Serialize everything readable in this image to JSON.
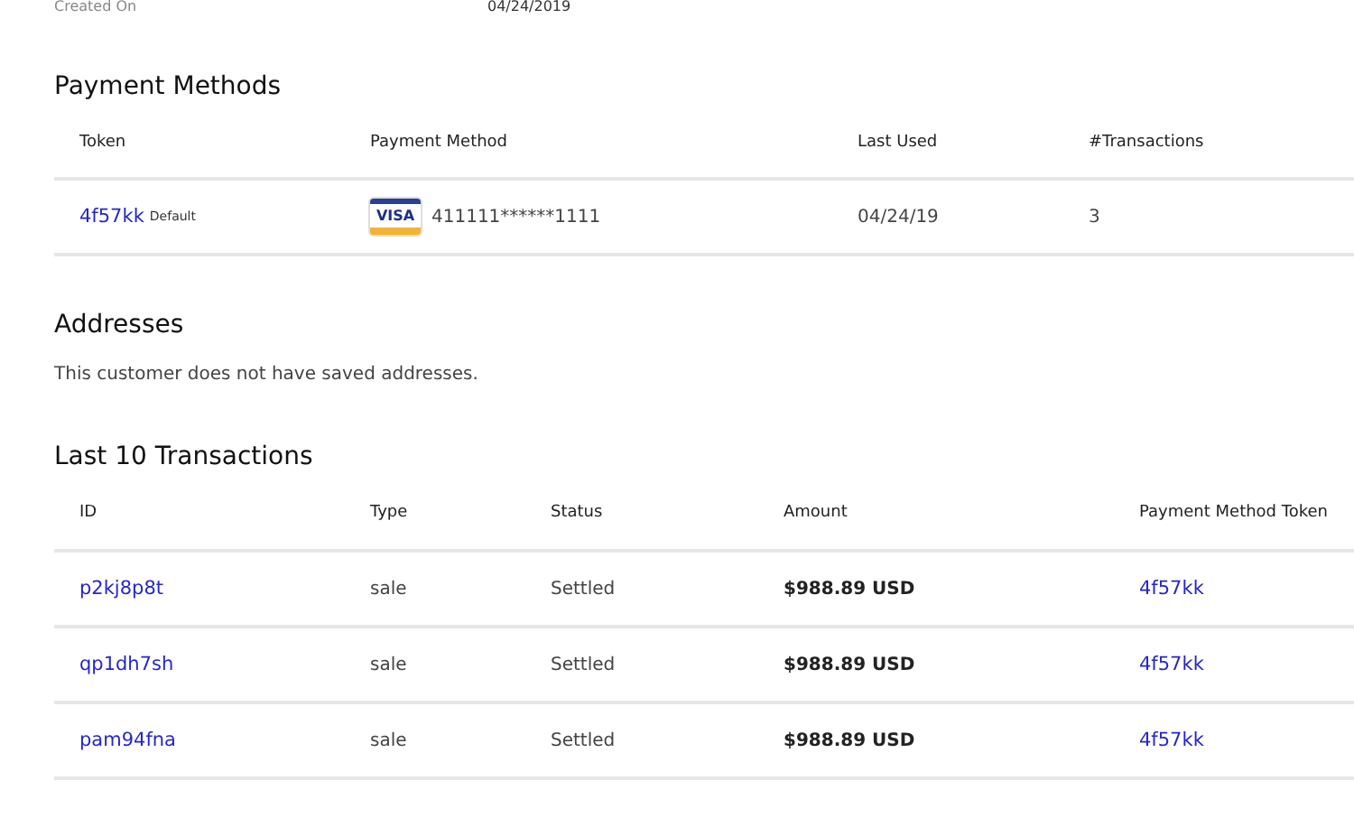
{
  "details": [
    {
      "label": "Created On",
      "value": "04/24/2019"
    }
  ],
  "payment_methods": {
    "title": "Payment Methods",
    "columns": [
      "Token",
      "Payment Method",
      "Last Used",
      "#Transactions"
    ],
    "rows": [
      {
        "token": "4f57kk",
        "badge": "Default",
        "card_brand": "VISA",
        "card_number": "411111******1111",
        "last_used": "04/24/19",
        "transactions": "3"
      }
    ]
  },
  "addresses": {
    "title": "Addresses",
    "message": "This customer does not have saved addresses."
  },
  "transactions": {
    "title": "Last 10 Transactions",
    "columns": [
      "ID",
      "Type",
      "Status",
      "Amount",
      "Payment Method Token"
    ],
    "rows": [
      {
        "id": "p2kj8p8t",
        "type": "sale",
        "status": "Settled",
        "amount": "$988.89 USD",
        "token": "4f57kk"
      },
      {
        "id": "qp1dh7sh",
        "type": "sale",
        "status": "Settled",
        "amount": "$988.89 USD",
        "token": "4f57kk"
      },
      {
        "id": "pam94fna",
        "type": "sale",
        "status": "Settled",
        "amount": "$988.89 USD",
        "token": "4f57kk"
      }
    ]
  }
}
